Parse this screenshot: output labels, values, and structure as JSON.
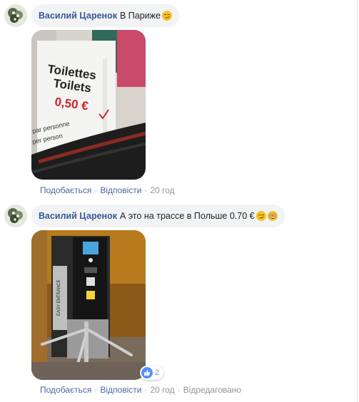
{
  "comments": [
    {
      "author": "Василий Царенок",
      "text": "В Париже",
      "emoji": [
        "smirking-face"
      ],
      "photo": {
        "sign_line1": "Toilettes",
        "sign_line2": "Toilets",
        "sign_price": "0,50 €",
        "sign_small1": "par personne",
        "sign_small2": "per person"
      },
      "actions": {
        "like": "Подобається",
        "reply": "Відповісти",
        "time": "20 год"
      }
    },
    {
      "author": "Василий Царенок",
      "text": "А это на трассе в Польше 0.70 €",
      "emoji": [
        "smirking-face",
        "flushed-face"
      ],
      "photo": {
        "machine_label": "EASY ENTRANCE"
      },
      "actions": {
        "like": "Подобається",
        "reply": "Відповісти",
        "time": "20 год",
        "edited": "Відредаговано"
      },
      "reactions": {
        "count": "2"
      }
    }
  ],
  "colors": {
    "author": "#385898",
    "bubble": "#f2f3f5",
    "action_link": "#4b67a1",
    "muted": "#90949c",
    "like_blue": "#5890ff"
  }
}
